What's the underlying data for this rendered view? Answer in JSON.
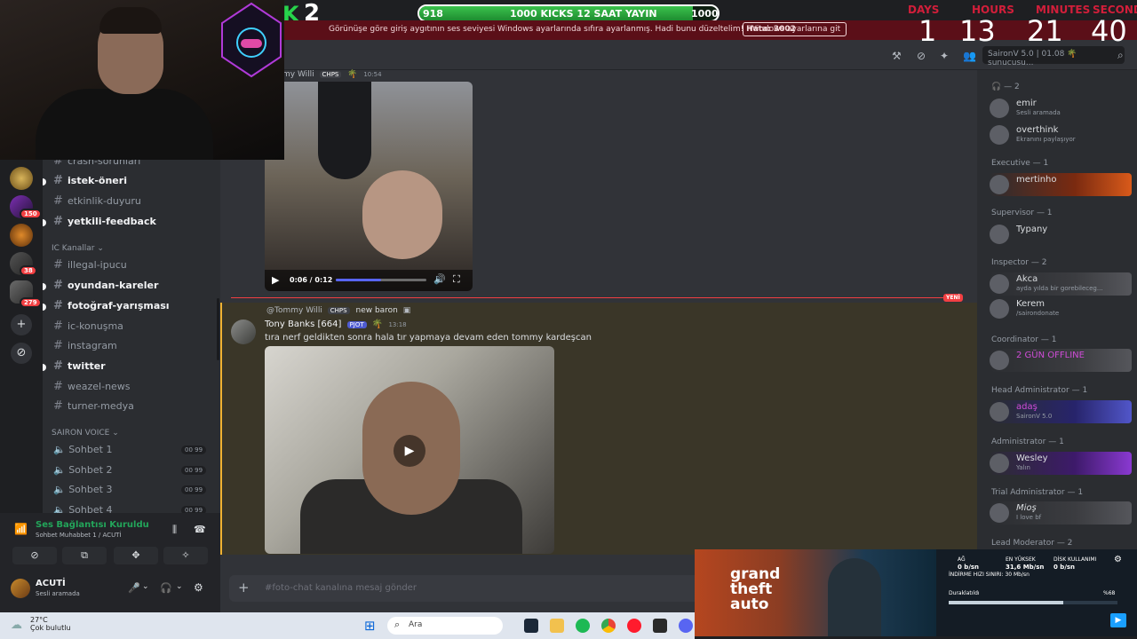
{
  "overlay": {
    "kick_count": "2",
    "kick_goal_current": "918",
    "kick_goal_label": "1000 KICKS 12 SAAT YAYIN",
    "kick_goal_target": "1000",
    "kick_goal_progress": 0.918,
    "timer": {
      "labels": [
        "DAYS",
        "HOURS",
        "MINUTES",
        "SECONDS"
      ],
      "values": [
        "1",
        "13",
        "21",
        "40"
      ]
    }
  },
  "banner": {
    "message": "Görünüşe göre giriş aygıtının ses seviyesi Windows ayarlarında sıfıra ayarlanmış. Hadi bunu düzeltelim!",
    "error": "Hata: 3002",
    "button": "Windows ayarlarına git"
  },
  "rail": {
    "badges": [
      "150",
      "38",
      "279"
    ]
  },
  "channels": {
    "partial_top": "crash-sorunları",
    "items_1": [
      {
        "name": "istek-öneri",
        "unread": true
      },
      {
        "name": "etkinlik-duyuru",
        "unread": false
      },
      {
        "name": "yetkili-feedback",
        "unread": true
      }
    ],
    "category_ic": "IC Kanallar",
    "items_2": [
      {
        "name": "illegal-ipucu",
        "unread": false
      },
      {
        "name": "oyundan-kareler",
        "unread": true
      },
      {
        "name": "fotoğraf-yarışması",
        "unread": true
      },
      {
        "name": "ic-konuşma",
        "unread": false
      },
      {
        "name": "instagram",
        "unread": false
      },
      {
        "name": "twitter",
        "unread": true
      },
      {
        "name": "weazel-news",
        "unread": false
      },
      {
        "name": "turner-medya",
        "unread": false
      }
    ],
    "category_voice": "SAIRON VOICE",
    "voice": [
      {
        "name": "Sohbet 1",
        "count": "00 99"
      },
      {
        "name": "Sohbet 2",
        "count": "00 99"
      },
      {
        "name": "Sohbet 3",
        "count": "00 99"
      },
      {
        "name": "Sohbet 4",
        "count": "00 99"
      }
    ]
  },
  "voice_panel": {
    "status": "Ses Bağlantısı Kuruldu",
    "channel": "Sohbet Muhabbet 1 / ACUTİ",
    "username": "ACUTİ",
    "user_status": "Sesli aramada"
  },
  "header": {
    "channel_partial": "t",
    "search_placeholder": "SaironV 5.0 | 01.08 🌴 sunucusu..."
  },
  "messages": {
    "first": {
      "author_partial": "my Willi",
      "tag": "CHPS",
      "time": "10:54",
      "video_time": "0:06 / 0:12",
      "video_progress": 0.5
    },
    "new_label": "YENİ",
    "second": {
      "reply_author": "@Tommy Willi",
      "reply_tag": "CHPS",
      "reply_text": "new baron",
      "author": "Tony Banks [664]",
      "author_tag": "PJOT",
      "time": "13:18",
      "text": "tıra nerf geldikten sonra hala tır yapmaya devam eden tommy kardeşcan"
    }
  },
  "composer": {
    "placeholder": "#foto-chat kanalına mesaj gönder"
  },
  "members": {
    "top_group": "— 2",
    "top": [
      {
        "name": "emir",
        "status": "Sesli aramada"
      },
      {
        "name": "overthink",
        "status": "Ekranını paylaşıyor"
      }
    ],
    "groups": [
      {
        "title": "Executive — 1",
        "members": [
          {
            "name": "mertinho",
            "status": ""
          }
        ]
      },
      {
        "title": "Supervisor — 1",
        "members": [
          {
            "name": "Typany",
            "status": ""
          }
        ]
      },
      {
        "title": "Inspector — 2",
        "members": [
          {
            "name": "Akca",
            "status": "ayda yılda bir gorebileceg..."
          },
          {
            "name": "Kerem",
            "status": "/sairondonate"
          }
        ]
      },
      {
        "title": "Coordinator — 1",
        "members": [
          {
            "name": "2 GÜN OFFLINE",
            "status": ""
          }
        ]
      },
      {
        "title": "Head Administrator — 1",
        "members": [
          {
            "name": "adaş",
            "status": "SaironV 5.0"
          }
        ]
      },
      {
        "title": "Administrator — 1",
        "members": [
          {
            "name": "Wesley",
            "status": "Yalın"
          }
        ]
      },
      {
        "title": "Trial Administrator — 1",
        "members": [
          {
            "name": "Mioş",
            "status": "I love bf"
          }
        ]
      }
    ],
    "last_group": "Lead Moderator — 2"
  },
  "net": {
    "labels": [
      "AĞ",
      "EN YÜKSEK",
      "DİSK KULLANIMI"
    ],
    "values": [
      "0 b/sn",
      "31,6 Mb/sn",
      "0 b/sn"
    ],
    "limit": "İNDİRME HIZI SINIRI: 30 Mb/sn",
    "state": "Duraklatıldı",
    "percent": "%68",
    "progress": 0.68
  },
  "gta": {
    "title_lines": [
      "grand",
      "theft",
      "auto"
    ]
  },
  "taskbar": {
    "temp": "27°C",
    "weather": "Çok bulutlu",
    "search": "Ara"
  },
  "colors": {
    "accent": "#5865f2",
    "online": "#23a55a",
    "alert": "#f23f42",
    "kick": "#27d34b"
  }
}
